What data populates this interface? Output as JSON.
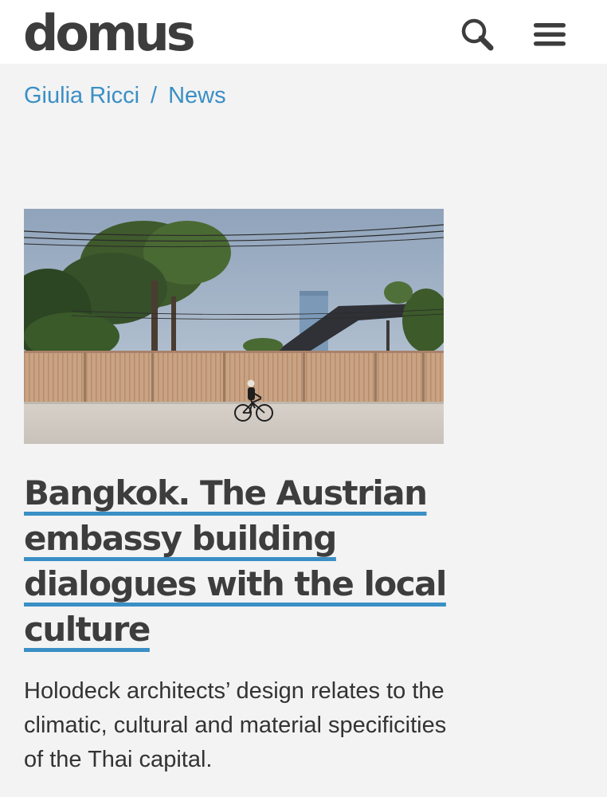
{
  "header": {
    "logo": "domus",
    "search_icon": "search-icon",
    "menu_icon": "hamburger-menu-icon"
  },
  "breadcrumb": {
    "author": "Giulia Ricci",
    "separator": "/",
    "section": "News"
  },
  "article": {
    "image_alt": "Bangkok. The Austrian embassy building dialogues with the local culture",
    "headline": "Bangkok. The Austrian embassy building dialogues with the local culture",
    "subtitle": "Holodeck architects’ design relates to the climatic, cultural and material specificities of the Thai capital."
  },
  "colors": {
    "accent": "#3a8fc5",
    "text": "#3d3d3d",
    "background": "#f3f3f3",
    "header_background": "#ffffff"
  }
}
